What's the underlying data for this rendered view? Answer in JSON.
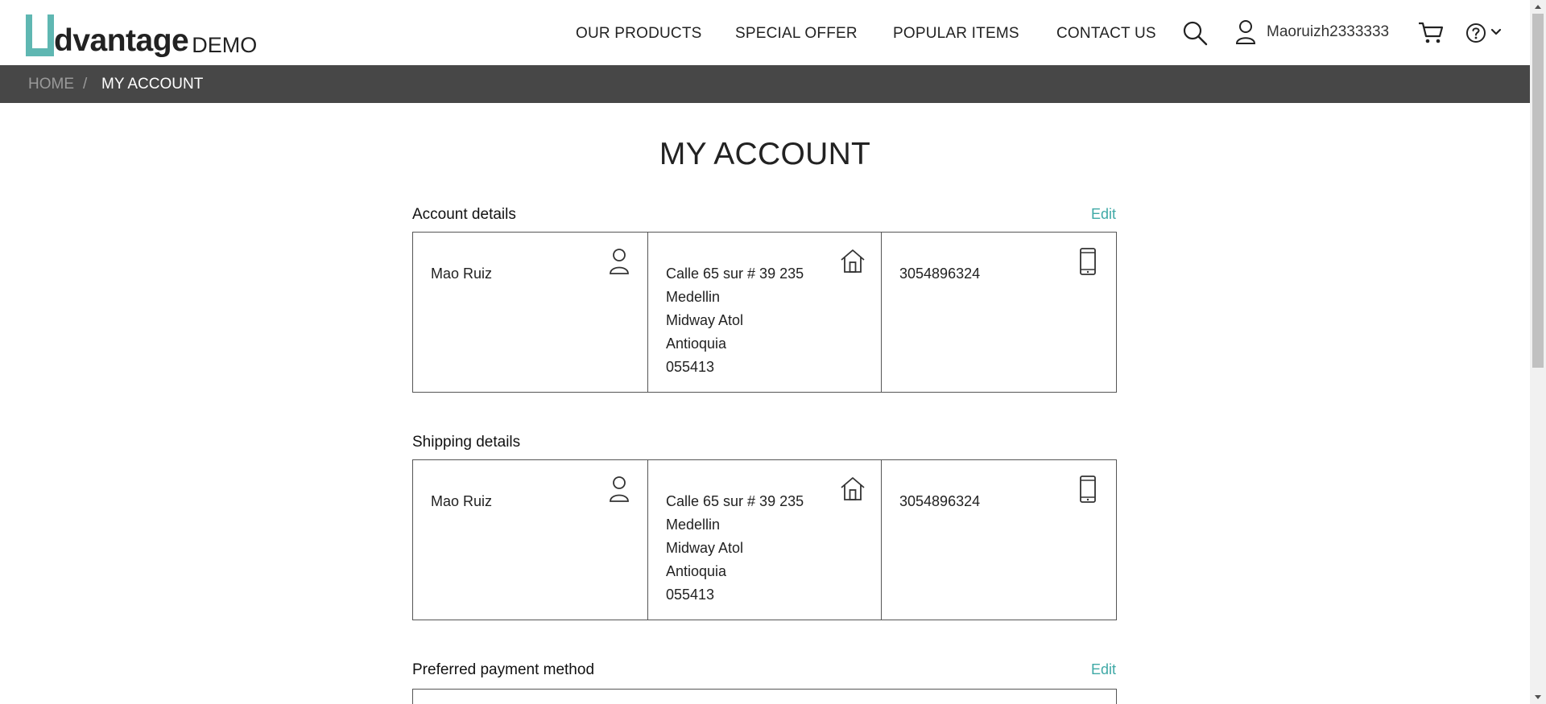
{
  "header": {
    "logo": {
      "word": "dvantage",
      "suffix": "DEMO",
      "accent_color": "#5fb7b2"
    },
    "nav": [
      "OUR PRODUCTS",
      "SPECIAL OFFER",
      "POPULAR ITEMS",
      "CONTACT US"
    ],
    "username": "Maoruizh2333333",
    "icons": [
      "search-icon",
      "user-icon",
      "cart-icon",
      "help-icon",
      "chevron-down-icon"
    ]
  },
  "breadcrumb": {
    "home": "HOME",
    "separator": "/",
    "current": "MY ACCOUNT"
  },
  "page_title": "MY ACCOUNT",
  "account_details": {
    "title": "Account details",
    "edit": "Edit",
    "name": "Mao Ruiz",
    "address": {
      "line1": "Calle 65 sur # 39 235",
      "city": "Medellin",
      "line3": "Midway Atol",
      "state": "Antioquia",
      "postal": "055413"
    },
    "phone": "3054896324"
  },
  "shipping_details": {
    "title": "Shipping details",
    "name": "Mao Ruiz",
    "address": {
      "line1": "Calle 65 sur # 39 235",
      "city": "Medellin",
      "line3": "Midway Atol",
      "state": "Antioquia",
      "postal": "055413"
    },
    "phone": "3054896324"
  },
  "payment": {
    "title": "Preferred payment method",
    "edit": "Edit"
  },
  "colors": {
    "breadcrumb_bg": "#474747",
    "accent": "#3fa9a6",
    "border": "#555555"
  }
}
